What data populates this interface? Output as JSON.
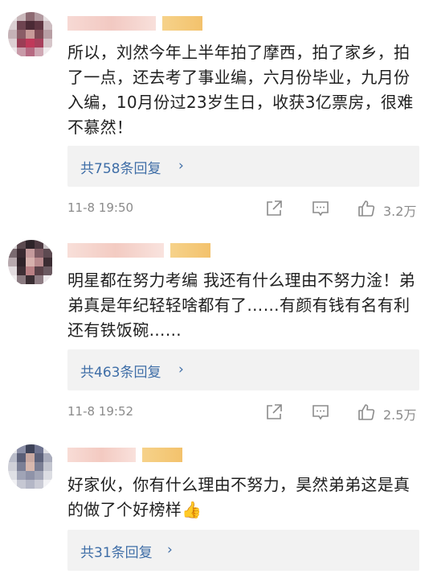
{
  "comments": [
    {
      "text": "所以，刘然今年上半年拍了摩西，拍了家乡，拍了一点，还去考了事业编，六月份毕业，九月份入编，10月份过23岁生日，收获3亿票房，很难不慕然！",
      "reply_label": "共758条回复",
      "time": "11-8 19:50",
      "likes": "3.2万"
    },
    {
      "text": "明星都在努力考编 我还有什么理由不努力淦！弟弟真是年纪轻轻啥都有了……有颜有钱有名有利还有铁饭碗……",
      "reply_label": "共463条回复",
      "time": "11-8 19:52",
      "likes": "2.5万"
    },
    {
      "text": "好家伙，你有什么理由不努力，昊然弟弟这是真的做了个好榜样👍",
      "reply_label": "共31条回复"
    }
  ],
  "icons": {
    "chevron": "›",
    "share": "share-icon",
    "comment": "comment-icon",
    "like": "thumbs-up-icon"
  },
  "colors": {
    "link": "#3f6ea7",
    "meta": "#8b8b8b",
    "reply_bg": "#f2f2f2"
  }
}
